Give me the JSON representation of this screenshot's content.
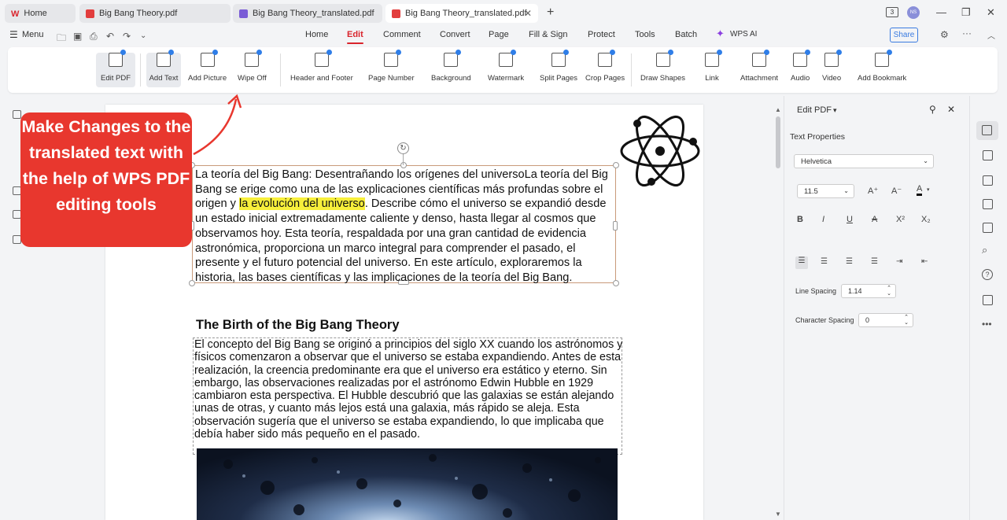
{
  "tabs": [
    {
      "label": "Home",
      "state": "inactive",
      "icon": "wps-logo-icon",
      "color": "#d9242c"
    },
    {
      "label": "Big Bang Theory.pdf",
      "state": "inactive",
      "icon": "pdf-icon",
      "color": "#e23d3d"
    },
    {
      "label": "Big Bang Theory_translated.pdf",
      "state": "inactive",
      "icon": "pdf-icon",
      "color": "#7a5cd6"
    },
    {
      "label": "Big Bang Theory_translated.pdf",
      "state": "active",
      "icon": "pdf-icon",
      "color": "#e23d3d"
    }
  ],
  "window": {
    "badge": "3",
    "avatar": "NS"
  },
  "menu": {
    "label": "Menu",
    "tabs": [
      "Home",
      "Edit",
      "Comment",
      "Convert",
      "Page",
      "Fill & Sign",
      "Protect",
      "Tools",
      "Batch",
      "WPS AI"
    ],
    "selected": "Edit",
    "share": "Share"
  },
  "ribbon": [
    "Edit PDF",
    "Add Text",
    "Add Picture",
    "Wipe Off",
    "Header and Footer",
    "Page Number",
    "Background",
    "Watermark",
    "Split Pages",
    "Crop Pages",
    "Draw Shapes",
    "Link",
    "Attachment",
    "Audio",
    "Video",
    "Add Bookmark"
  ],
  "callout": {
    "text": "Make Changes to the translated text with the help of WPS PDF editing tools",
    "color": "#e8372e"
  },
  "doc": {
    "para1_before": "La teoría del Big Bang: Desentrañando los orígenes del universoLa teoría del Big Bang se erige como una de las explicaciones científicas más profundas sobre el origen y ",
    "para1_highlight": "la evolución del universo",
    "para1_after": ". Describe cómo el universo se expandió desde un estado inicial extremadamente caliente y denso, hasta llegar al cosmos que observamos hoy. Esta teoría, respaldada por una gran cantidad de evidencia astronómica, proporciona un marco integral para comprender el pasado, el presente y el futuro potencial del universo. En este artículo, exploraremos la historia, las bases científicas y las implicaciones de la teoría del Big Bang.",
    "heading": "The Birth of the Big Bang Theory",
    "para2": "El concepto del Big Bang se originó a principios del siglo XX cuando los astrónomos y físicos comenzaron a observar que el universo se estaba expandiendo. Antes de esta realización, la creencia predominante era que el universo era estático y eterno. Sin embargo, las observaciones realizadas por el astrónomo Edwin Hubble en 1929 cambiaron esta perspectiva. El Hubble descubrió que las galaxias se están alejando unas de otras, y cuanto más lejos está una galaxia, más rápido se aleja. Esta observación sugería que el universo se estaba expandiendo, lo que implicaba que debía haber sido más pequeño en el pasado.",
    "highlight_color": "#f7ef3b"
  },
  "panel": {
    "title": "Edit PDF",
    "section": "Text Properties",
    "font": "Helvetica",
    "size": "11.5",
    "line_spacing_label": "Line Spacing",
    "line_spacing": "1.14",
    "char_spacing_label": "Character Spacing",
    "char_spacing": "0"
  },
  "accent": "#d9242c"
}
